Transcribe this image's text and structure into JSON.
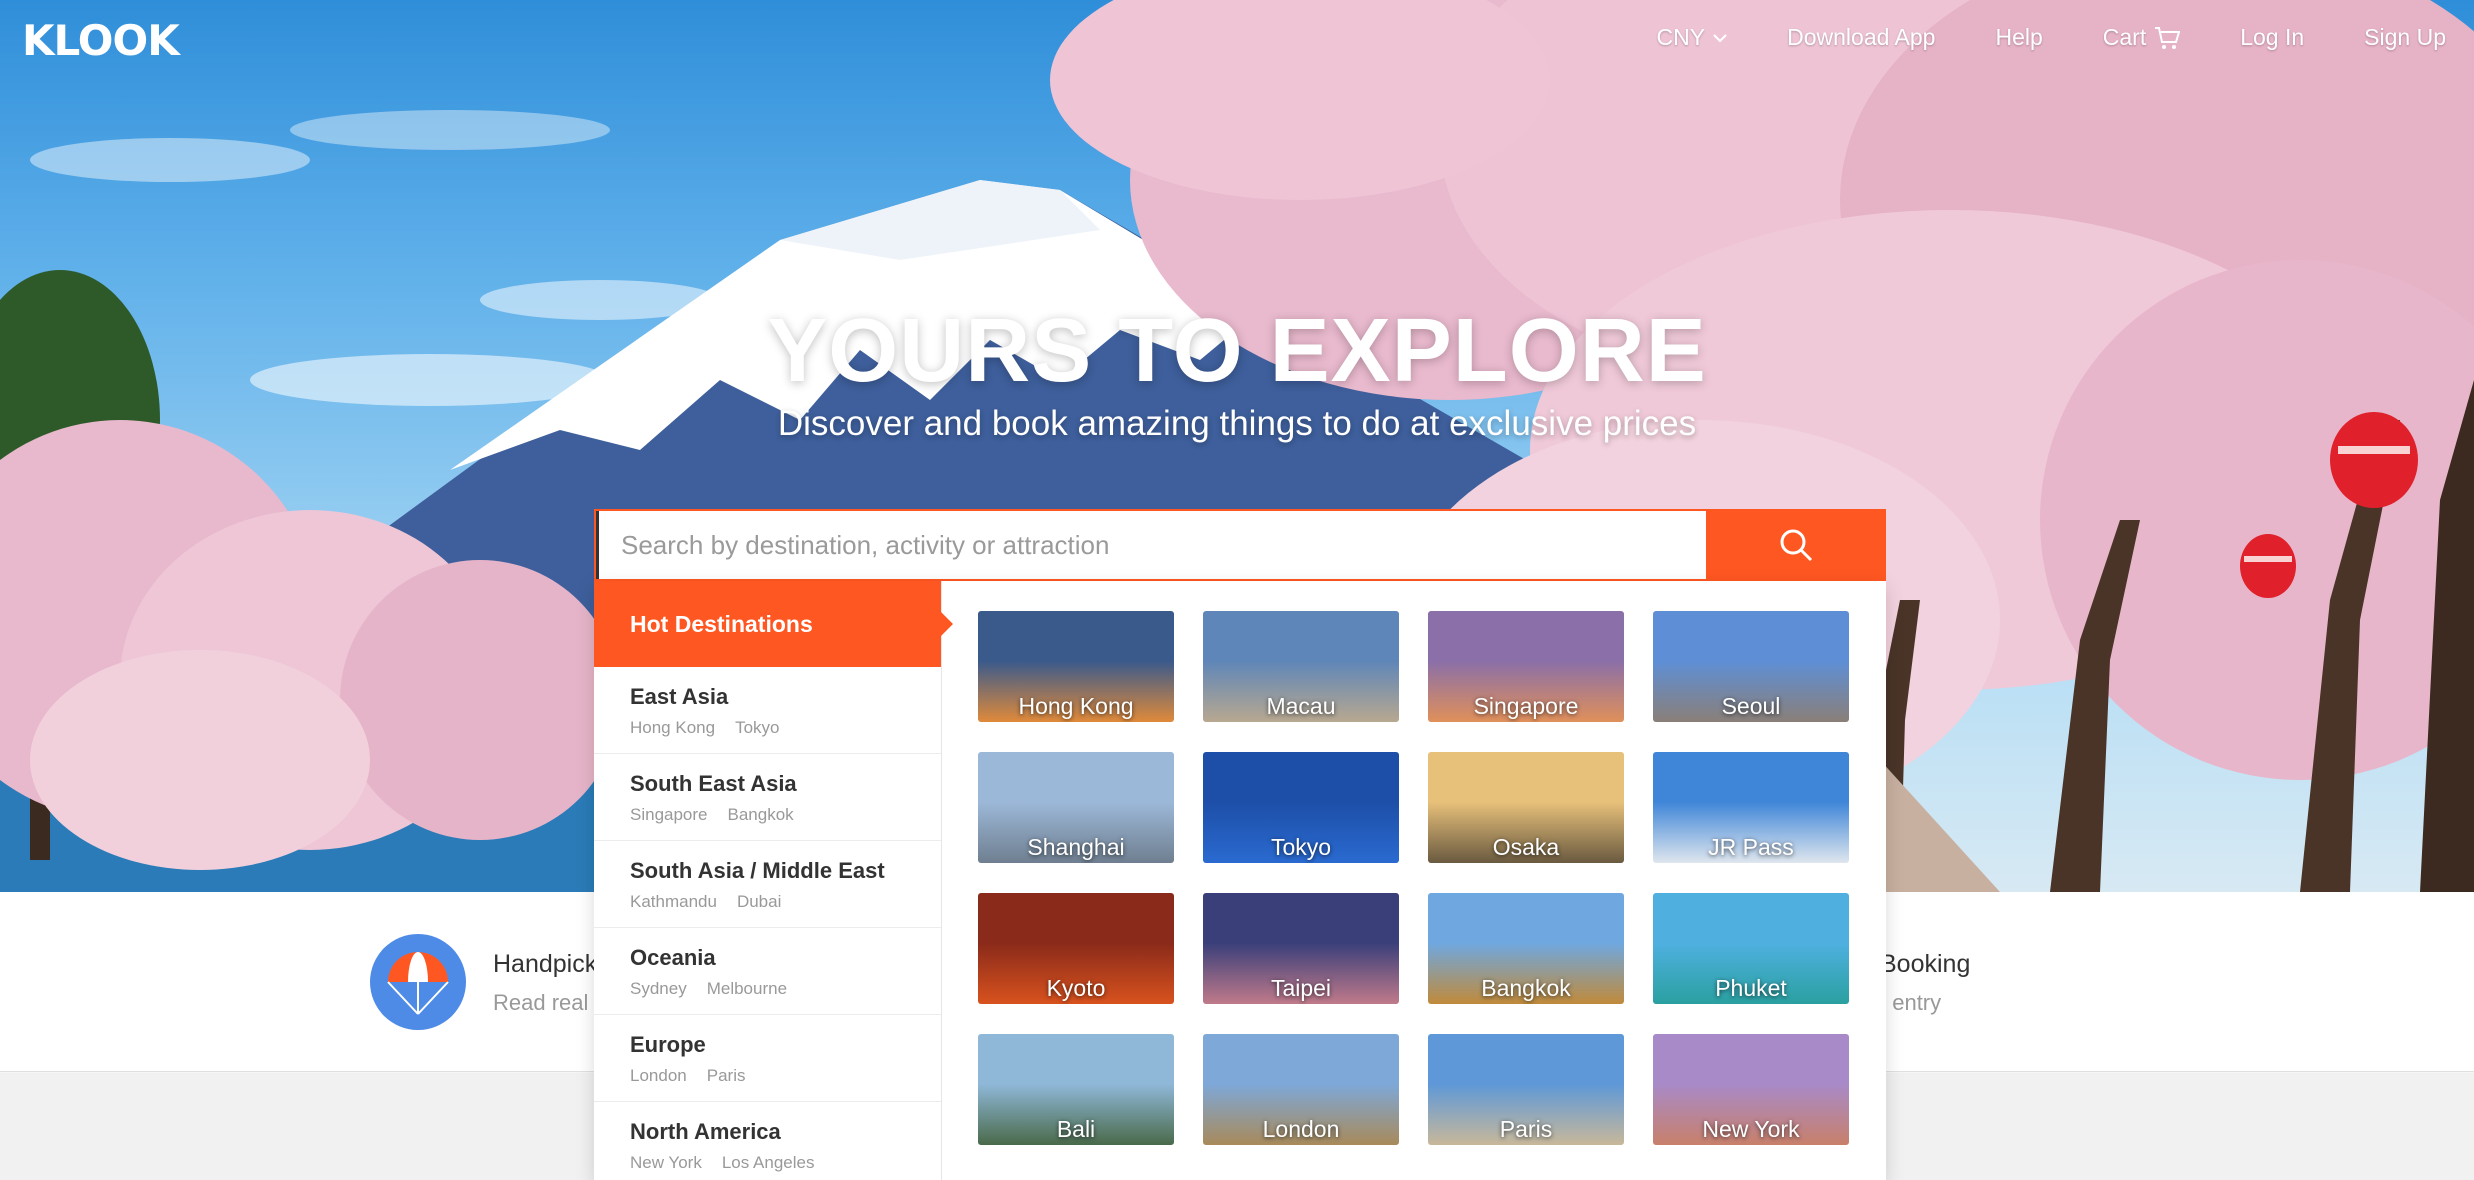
{
  "brand": {
    "logo": "KLOOK",
    "accent": "#ff5722"
  },
  "nav": {
    "currency": "CNY",
    "download": "Download App",
    "help": "Help",
    "cart": "Cart",
    "login": "Log In",
    "signup": "Sign Up"
  },
  "hero": {
    "headline": "YOURS TO EXPLORE",
    "subline": "Discover and book amazing things to do at exclusive prices"
  },
  "search": {
    "placeholder": "Search by destination, activity or attraction",
    "button_icon": "search-icon"
  },
  "dropdown": {
    "active_tab": "Hot Destinations",
    "regions": [
      {
        "name": "East Asia",
        "cities": [
          "Hong Kong",
          "Tokyo"
        ]
      },
      {
        "name": "South East Asia",
        "cities": [
          "Singapore",
          "Bangkok"
        ]
      },
      {
        "name": "South Asia / Middle East",
        "cities": [
          "Kathmandu",
          "Dubai"
        ]
      },
      {
        "name": "Oceania",
        "cities": [
          "Sydney",
          "Melbourne"
        ]
      },
      {
        "name": "Europe",
        "cities": [
          "London",
          "Paris"
        ]
      },
      {
        "name": "North America",
        "cities": [
          "New York",
          "Los Angeles"
        ]
      }
    ],
    "destinations": [
      {
        "name": "Hong Kong",
        "sky": "#3a5a8c",
        "ground": "#e08a3a"
      },
      {
        "name": "Macau",
        "sky": "#5f86b8",
        "ground": "#b8a890"
      },
      {
        "name": "Singapore",
        "sky": "#8a6fa8",
        "ground": "#e0905a"
      },
      {
        "name": "Seoul",
        "sky": "#5e8fd6",
        "ground": "#8a7f78"
      },
      {
        "name": "Shanghai",
        "sky": "#9cb8d8",
        "ground": "#6f7f90"
      },
      {
        "name": "Tokyo",
        "sky": "#1d4fa8",
        "ground": "#2a6ad0"
      },
      {
        "name": "Osaka",
        "sky": "#e7c07a",
        "ground": "#6a5a40"
      },
      {
        "name": "JR Pass",
        "sky": "#3f86d8",
        "ground": "#dfe6ee"
      },
      {
        "name": "Kyoto",
        "sky": "#8a2a1a",
        "ground": "#d8521e"
      },
      {
        "name": "Taipei",
        "sky": "#3a3f7a",
        "ground": "#c07a8a"
      },
      {
        "name": "Bangkok",
        "sky": "#6fa8e0",
        "ground": "#c08a3a"
      },
      {
        "name": "Phuket",
        "sky": "#4fb0e0",
        "ground": "#2aa0a0"
      },
      {
        "name": "Bali",
        "sky": "#8fb8d8",
        "ground": "#4a6a4a"
      },
      {
        "name": "London",
        "sky": "#7ea8d8",
        "ground": "#a88a5a"
      },
      {
        "name": "Paris",
        "sky": "#5e98d8",
        "ground": "#c8b89a"
      },
      {
        "name": "New York",
        "sky": "#a88ac8",
        "ground": "#c8806a"
      }
    ]
  },
  "features": {
    "left_title": "Handpick",
    "left_desc": "Read real",
    "right_title": "Booking",
    "right_desc": "t entry"
  }
}
